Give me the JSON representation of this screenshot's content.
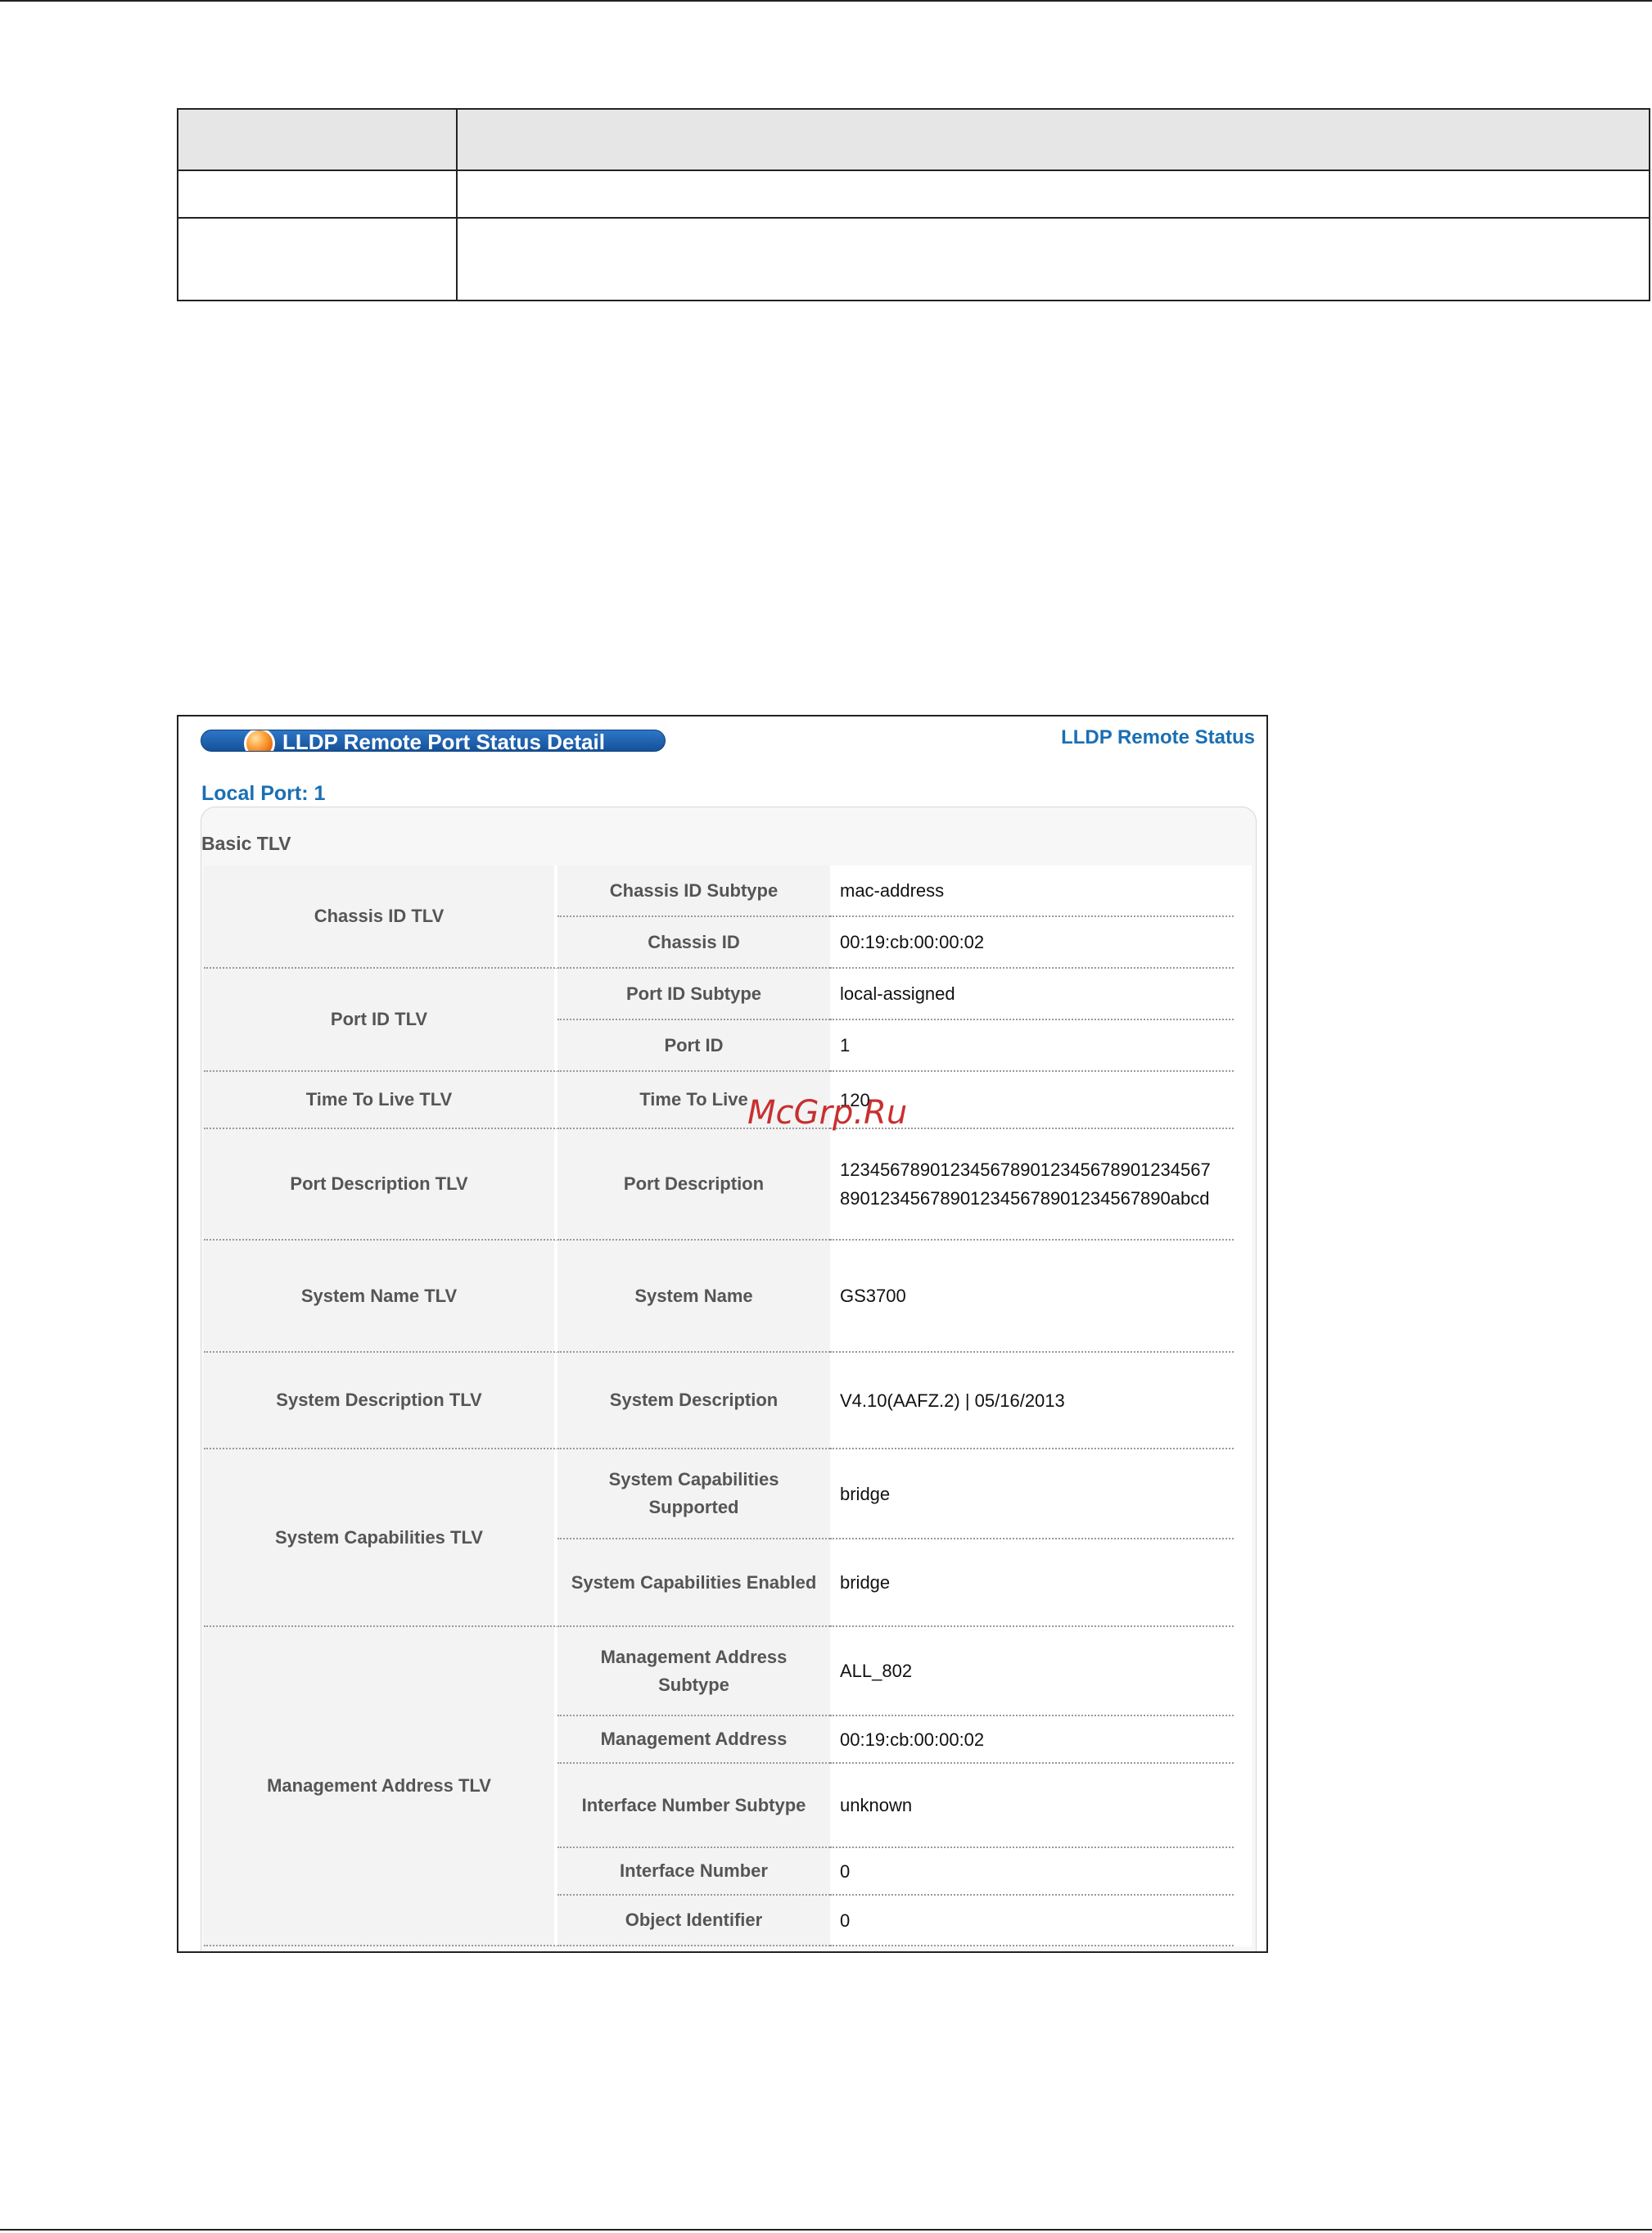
{
  "document": {
    "table_rows": [
      {
        "col1": "",
        "col2": ""
      },
      {
        "col1": "",
        "col2": ""
      },
      {
        "col1": "",
        "col2": ""
      }
    ]
  },
  "screenshot": {
    "title": "LLDP Remote Port Status Detail",
    "remote_status_link": "LLDP Remote Status",
    "local_port": "Local Port: 1",
    "section_label": "Basic TLV",
    "groups": [
      {
        "name": "Chassis ID TLV",
        "fields": [
          {
            "label": "Chassis ID Subtype",
            "value": "mac-address"
          },
          {
            "label": "Chassis ID",
            "value": "00:19:cb:00:00:02"
          }
        ]
      },
      {
        "name": "Port ID TLV",
        "fields": [
          {
            "label": "Port ID Subtype",
            "value": "local-assigned"
          },
          {
            "label": "Port ID",
            "value": "1"
          }
        ]
      },
      {
        "name": "Time To Live TLV",
        "fields": [
          {
            "label": "Time To Live",
            "value": "120"
          }
        ]
      },
      {
        "name": "Port Description TLV",
        "fields": [
          {
            "label": "Port Description",
            "value": "1234567890123456789012345678901234567890123456789012345678901234567890abcd"
          }
        ]
      },
      {
        "name": "System Name TLV",
        "fields": [
          {
            "label": "System Name",
            "value": "GS3700"
          }
        ]
      },
      {
        "name": "System Description TLV",
        "fields": [
          {
            "label": "System Description",
            "value": "V4.10(AAFZ.2) | 05/16/2013"
          }
        ]
      },
      {
        "name": "System Capabilities TLV",
        "fields": [
          {
            "label": "System Capabilities Supported",
            "value": "bridge"
          },
          {
            "label": "System Capabilities Enabled",
            "value": "bridge"
          }
        ]
      },
      {
        "name": "Management Address TLV",
        "fields": [
          {
            "label": "Management Address Subtype",
            "value": "ALL_802"
          },
          {
            "label": "Management Address",
            "value": "00:19:cb:00:00:02"
          },
          {
            "label": "Interface Number Subtype",
            "value": "unknown"
          },
          {
            "label": "Interface Number",
            "value": "0"
          },
          {
            "label": "Object Identifier",
            "value": "0"
          }
        ]
      }
    ]
  },
  "watermark": "McGrp.Ru"
}
